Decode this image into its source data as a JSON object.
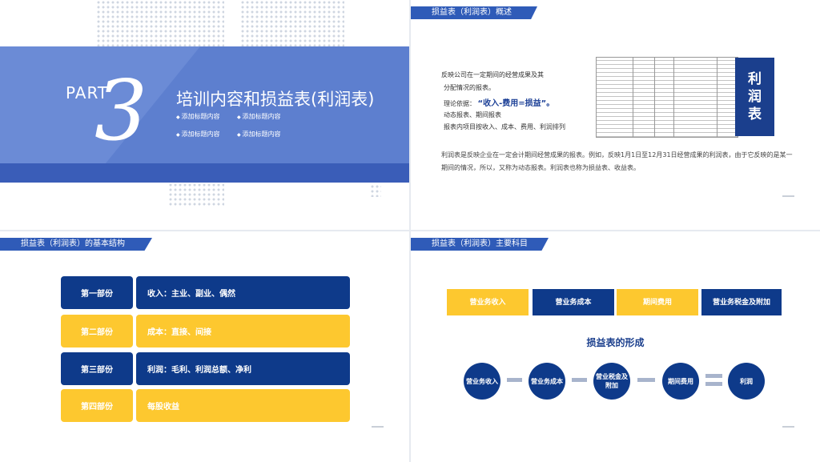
{
  "slide1": {
    "part": "PART",
    "number": "3",
    "title": "培训内容和损益表(利润表)",
    "items": [
      "添加标题内容",
      "添加标题内容",
      "添加标题内容",
      "添加标题内容"
    ]
  },
  "slide2": {
    "header": "损益表（利润表）概述",
    "lines": [
      "反映公司在一定期间的经营成果及其",
      "分配情况的报表。"
    ],
    "basis_label": "理论依据：",
    "formula": "“收入-费用=损益”。",
    "line_dynamic": "动态报表、期间报表",
    "line_items": "报表内项目按收入、成本、费用、利润排列",
    "vertical_title": [
      "利",
      "润",
      "表"
    ],
    "paragraph": "利润表是反映企业在一定会计期间经营成果的报表。例如，反映1月1日至12月31日经营成果的利润表，由于它反映的是某一期间的情况，所以，又称为动态报表。利润表也称为损益表、收益表。"
  },
  "slide3": {
    "header": "损益表（利润表）的基本结构",
    "rows": [
      {
        "left": "第一部份",
        "right": "收入：主业、副业、偶然",
        "color": "navy"
      },
      {
        "left": "第二部份",
        "right": "成本：直接、间接",
        "color": "yellow"
      },
      {
        "left": "第三部份",
        "right": "利润：毛利、利润总额、净利",
        "color": "navy"
      },
      {
        "left": "第四部份",
        "right": "每股收益",
        "color": "yellow"
      }
    ]
  },
  "slide4": {
    "header": "损益表（利润表）主要科目",
    "boxes": [
      "营业务收入",
      "营业务成本",
      "期间费用",
      "营业务税金及附加"
    ],
    "subtitle": "损益表的形成",
    "circles": [
      "营业务收入",
      "营业务成本",
      "营业税金及附加",
      "期间费用",
      "利润"
    ]
  },
  "colors": {
    "navy": "#0e3a8a",
    "yellow": "#fdc82f",
    "blue": "#5d7fcf"
  }
}
